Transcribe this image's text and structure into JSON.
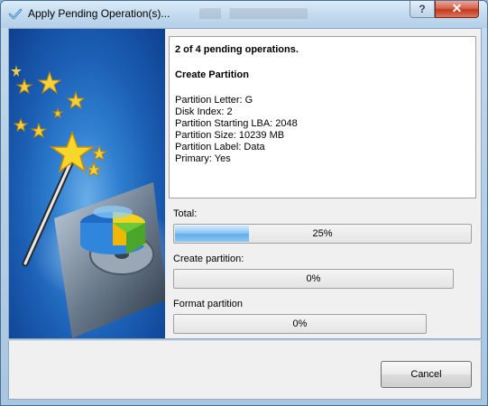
{
  "window": {
    "title": "Apply Pending Operation(s)...",
    "help_label": "?",
    "close_label": "✕",
    "title_icon": "checkmark-icon"
  },
  "info": {
    "op_count": "2 of 4 pending operations.",
    "op_name": "Create Partition",
    "details": [
      "Partition Letter: G",
      "Disk Index: 2",
      "Partition Starting LBA: 2048",
      "Partition Size: 10239 MB",
      "Partition Label: Data",
      "Primary: Yes"
    ]
  },
  "progress": {
    "total_label": "Total:",
    "total_pct": "25%",
    "total_value": 0.25,
    "create_label": "Create partition:",
    "create_pct": "0%",
    "create_value": 0,
    "format_label": "Format partition",
    "format_pct": "0%",
    "format_value": 0
  },
  "footer": {
    "cancel_label": "Cancel"
  },
  "art": {
    "icon": "partition-wizard-magic-wand-illustration"
  }
}
